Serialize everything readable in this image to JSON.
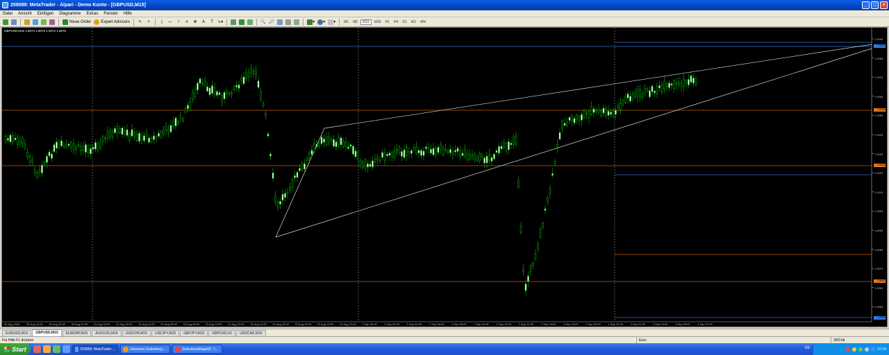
{
  "window": {
    "title": "259089: MetaTrader - Alpari - Demo Konto - [GBPUSD,M15]"
  },
  "menu": [
    "Datei",
    "Ansicht",
    "Einfügen",
    "Diagramme",
    "Extras",
    "Fenster",
    "Hilfe"
  ],
  "toolbar": {
    "new_order": "Neue Order",
    "expert_advisors": "Expert Advisors",
    "timeframes": [
      "M1",
      "M5",
      "M15",
      "M30",
      "H1",
      "H4",
      "D1",
      "W1",
      "MN"
    ]
  },
  "chart": {
    "symbol_header": "GBPUSD,M15  1.9074 1.9076 1.9072 1.9075",
    "price_ticks": [
      "1.9095",
      "1.9085",
      "1.9075",
      "1.9065",
      "1.9055",
      "1.9045",
      "1.9035",
      "1.9025",
      "1.9015",
      "1.9005",
      "1.8995",
      "1.8985",
      "1.8975",
      "1.8965",
      "1.8955"
    ],
    "time_ticks": [
      "30 Aug 2006",
      "30 Aug 16:00",
      "30 Aug 20:00",
      "30 Aug 22:00",
      "31 Aug 00:00",
      "31 Aug 02:00",
      "31 Aug 04:00",
      "31 Aug 06:00",
      "31 Aug 08:00",
      "31 Aug 10:00",
      "31 Aug 12:00",
      "31 Aug 14:00",
      "31 Aug 16:00",
      "31 Aug 18:00",
      "31 Aug 20:00",
      "31 Aug 22:00",
      "1 Sep 00:00",
      "1 Sep 02:00",
      "1 Sep 04:00",
      "1 Sep 06:00",
      "1 Sep 08:00",
      "1 Sep 10:00",
      "1 Sep 12:00",
      "1 Sep 14:00",
      "1 Sep 16:00",
      "1 Sep 18:00",
      "1 Sep 20:00",
      "1 Sep 22:00",
      "4 Sep 01:00",
      "4 Sep 03:00",
      "4 Sep 05:00",
      "4 Sep 07:00"
    ],
    "price_tags": [
      {
        "label": "1.9090",
        "color": "#2f7fe8"
      },
      {
        "label": "1.9058",
        "color": "#e07820"
      },
      {
        "label": "1.9028",
        "color": "#e07820"
      },
      {
        "label": "1.8962",
        "color": "#e07820"
      },
      {
        "label": "1.8950",
        "color": "#2f7fe8"
      }
    ],
    "colors": {
      "background": "#000000",
      "bull": "#ffffff",
      "bear": "#00c000",
      "orange_line": "#c06010",
      "blue_line": "#3070d0",
      "grid": "#808080"
    }
  },
  "tabs": [
    "EURUSD,M15",
    "GBPUSD,M15",
    "EURGBP,M15",
    "AUDUSD,M15",
    "USDCHF,M15",
    "USDJPY,M15",
    "GBPJPY,M15",
    "GBPUSD,H1",
    "USDCAD,M15"
  ],
  "active_tab": "GBPUSD,M15",
  "status": {
    "help": "Für Hilfe F1 drücken",
    "profile": "Euro",
    "traffic": "29/0 kb"
  },
  "taskbar": {
    "start": "Start",
    "tasks": [
      "259089: MetaTrader ...",
      "Johannes Gutenberg-...",
      "Zwischenablage02 - I..."
    ],
    "lang": "DE",
    "clock": "07:24"
  }
}
